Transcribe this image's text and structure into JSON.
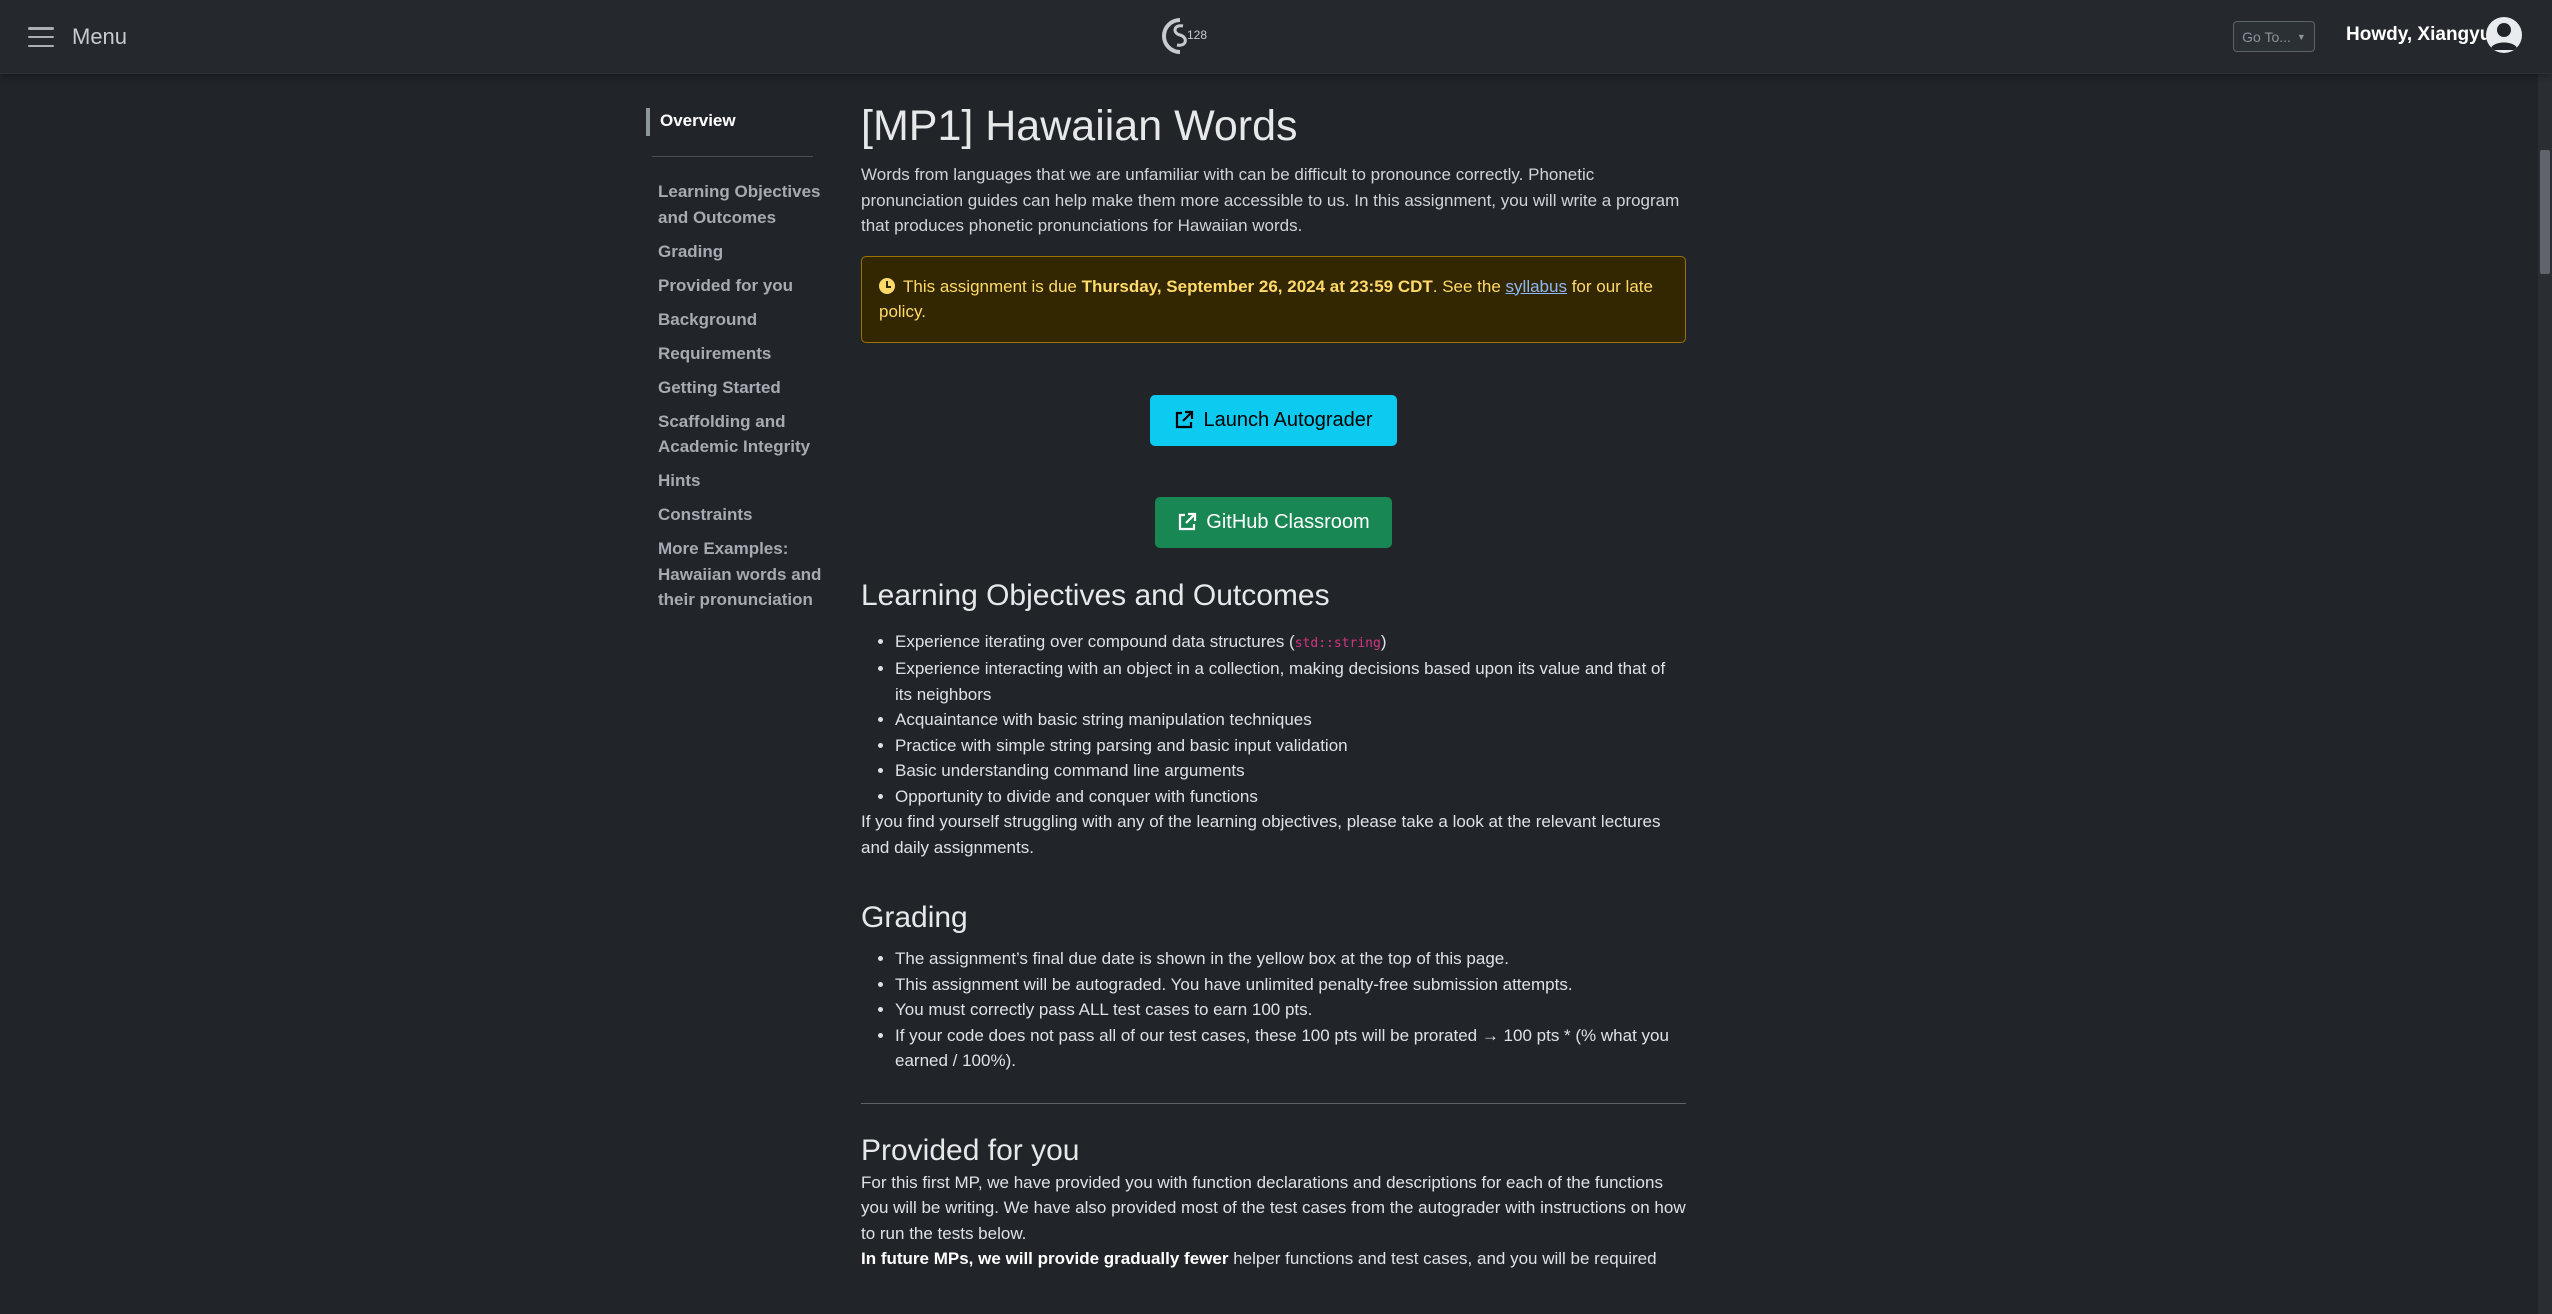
{
  "navbar": {
    "menu_label": "Menu",
    "logo_text": "128",
    "goto_label": "Go To...",
    "greeting": "Howdy, Xiangyu!"
  },
  "sidebar": {
    "active": "Overview",
    "items": [
      {
        "label": "Learning Objectives and Outcomes"
      },
      {
        "label": "Grading"
      },
      {
        "label": "Provided for you"
      },
      {
        "label": "Background"
      },
      {
        "label": "Requirements"
      },
      {
        "label": "Getting Started"
      },
      {
        "label": "Scaffolding and Academic Integrity"
      },
      {
        "label": "Hints"
      },
      {
        "label": "Constraints"
      },
      {
        "label": "More Examples: Hawaiian words and their pronunciation"
      }
    ]
  },
  "main": {
    "title": "[MP1] Hawaiian Words",
    "intro": "Words from languages that we are unfamiliar with can be difficult to pronounce correctly. Phonetic pronunciation guides can help make them more accessible to us. In this assignment, you will write a program that produces phonetic pronunciations for Hawaiian words.",
    "alert": {
      "prefix": "This assignment is due ",
      "due_date": "Thursday, September 26, 2024 at 23:59 CDT",
      "middle": ". See the ",
      "link": "syllabus",
      "suffix": " for our late policy."
    },
    "autograder_label": "Launch Autograder",
    "github_label": "GitHub Classroom",
    "learning": {
      "heading": "Learning Objectives and Outcomes",
      "first_item_prefix": "Experience iterating over compound data structures (",
      "first_item_code": "std::string",
      "first_item_suffix": ")",
      "items": [
        "Experience interacting with an object in a collection, making decisions based upon its value and that of its neighbors",
        "Acquaintance with basic string manipulation techniques",
        "Practice with simple string parsing and basic input validation",
        "Basic understanding command line arguments",
        "Opportunity to divide and conquer with functions"
      ],
      "note": "If you find yourself struggling with any of the learning objectives, please take a look at the relevant lectures and daily assignments."
    },
    "grading": {
      "heading": "Grading",
      "items": [
        "The assignment’s final due date is shown in the yellow box at the top of this page.",
        "This assignment will be autograded. You have unlimited penalty-free submission attempts.",
        "You must correctly pass ALL test cases to earn 100 pts.",
        "If your code does not pass all of our test cases, these 100 pts will be prorated → 100 pts * (% what you earned / 100%)."
      ]
    },
    "provided": {
      "heading": "Provided for you",
      "paragraph": "For this first MP, we have provided you with function declarations and descriptions for each of the functions you will be writing. We have also provided most of the test cases from the autograder with instructions on how to run the tests below.",
      "future_bold": "In future MPs, we will provide gradually fewer",
      "future_rest": " helper functions and test cases, and you will be required"
    }
  }
}
